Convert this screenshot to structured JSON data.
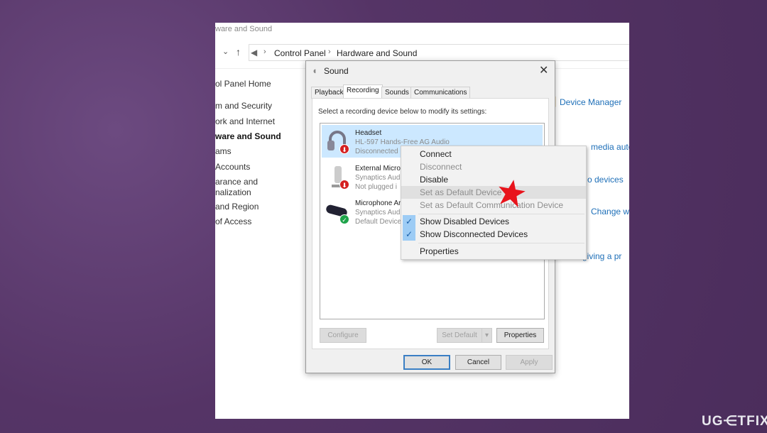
{
  "window": {
    "title_fragment": "ware and Sound"
  },
  "breadcrumb": {
    "items": [
      "Control Panel",
      "Hardware and Sound"
    ]
  },
  "nav": {
    "items": [
      "ol Panel Home",
      "m and Security",
      "ork and Internet",
      "ware and Sound",
      "ams",
      "Accounts",
      "arance and",
      "nalization",
      " and Region",
      "of Access"
    ],
    "active_index": 3
  },
  "right_links": [
    "Device Manager",
    "media auto",
    "o devices",
    "Change wh",
    "giving a pr"
  ],
  "dialog": {
    "title": "Sound",
    "tabs": [
      "Playback",
      "Recording",
      "Sounds",
      "Communications"
    ],
    "active_tab": "Recording",
    "instruction": "Select a recording device below to modify its settings:",
    "devices": [
      {
        "name": "Headset",
        "desc": "HL-597 Hands-Free AG Audio",
        "status": "Disconnected",
        "badge": "down-arrow",
        "selected": true
      },
      {
        "name": "External Microp",
        "desc": "Synaptics Audi",
        "status": "Not plugged i",
        "badge": "down-arrow"
      },
      {
        "name": "Microphone Ar",
        "desc": "Synaptics Audi",
        "status": "Default Device",
        "badge": "check"
      }
    ],
    "buttons": {
      "configure": "Configure",
      "set_default": "Set Default",
      "properties": "Properties",
      "ok": "OK",
      "cancel": "Cancel",
      "apply": "Apply"
    }
  },
  "context_menu": {
    "items": [
      {
        "label": "Connect",
        "enabled": true
      },
      {
        "label": "Disconnect",
        "enabled": false
      },
      {
        "label": "Disable",
        "enabled": true
      },
      {
        "label": "Set as Default Device",
        "enabled": false,
        "highlighted": true
      },
      {
        "label": "Set as Default Communication Device",
        "enabled": false
      },
      {
        "label": "Show Disabled Devices",
        "checked": true
      },
      {
        "label": "Show Disconnected Devices",
        "checked": true
      },
      {
        "label": "Properties",
        "enabled": true
      }
    ]
  },
  "watermark": "UG⋲TFIX",
  "colors": {
    "background": "#5a3a6c",
    "selection": "#cce8ff",
    "link": "#1e6fb8",
    "star": "#e8141c"
  }
}
